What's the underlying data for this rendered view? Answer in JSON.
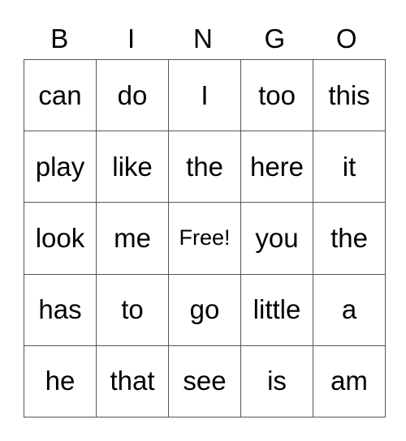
{
  "header": {
    "letters": [
      "B",
      "I",
      "N",
      "G",
      "O"
    ]
  },
  "grid": {
    "rows": [
      [
        "can",
        "do",
        "I",
        "too",
        "this"
      ],
      [
        "play",
        "like",
        "the",
        "here",
        "it"
      ],
      [
        "look",
        "me",
        "Free!",
        "you",
        "the"
      ],
      [
        "has",
        "to",
        "go",
        "little",
        "a"
      ],
      [
        "he",
        "that",
        "see",
        "is",
        "am"
      ]
    ],
    "free_cell": {
      "row": 2,
      "col": 2
    }
  }
}
